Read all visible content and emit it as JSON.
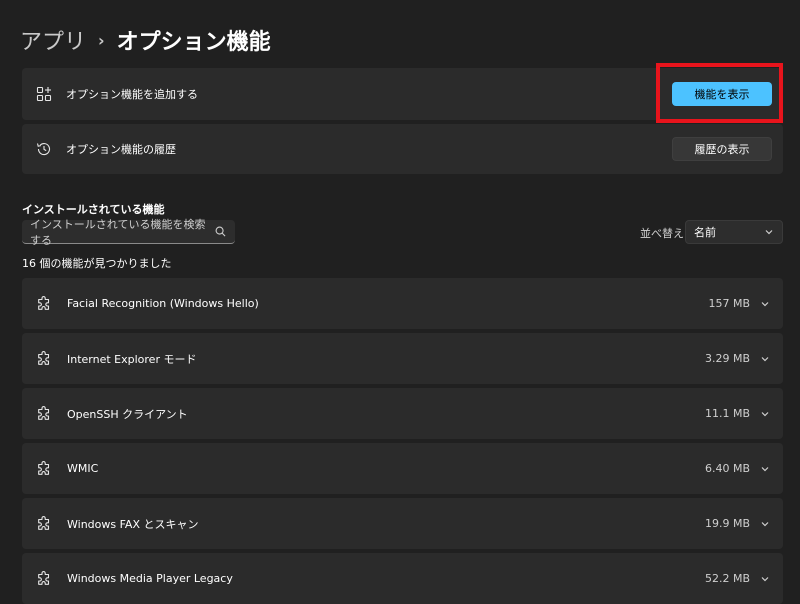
{
  "breadcrumb": {
    "parent": "アプリ",
    "separator": "›",
    "current": "オプション機能"
  },
  "add_card": {
    "label": "オプション機能を追加する",
    "button_label": "機能を表示",
    "icon": "add-apps-icon"
  },
  "history_card": {
    "label": "オプション機能の履歴",
    "button_label": "履歴の表示",
    "icon": "history-icon"
  },
  "installed": {
    "title": "インストールされている機能",
    "search_placeholder": "インストールされている機能を検索する",
    "sort_label": "並べ替え:",
    "sort_value": "名前",
    "count_text": "16 個の機能が見つかりました"
  },
  "features": [
    {
      "name": "Facial Recognition (Windows Hello)",
      "size": "157 MB"
    },
    {
      "name": "Internet Explorer モード",
      "size": "3.29 MB"
    },
    {
      "name": "OpenSSH クライアント",
      "size": "11.1 MB"
    },
    {
      "name": "WMIC",
      "size": "6.40 MB"
    },
    {
      "name": "Windows FAX とスキャン",
      "size": "19.9 MB"
    },
    {
      "name": "Windows Media Player Legacy",
      "size": "52.2 MB"
    }
  ],
  "colors": {
    "background": "#202020",
    "card": "#2b2b2b",
    "accent": "#4cc2ff",
    "highlight": "#e8141c"
  }
}
